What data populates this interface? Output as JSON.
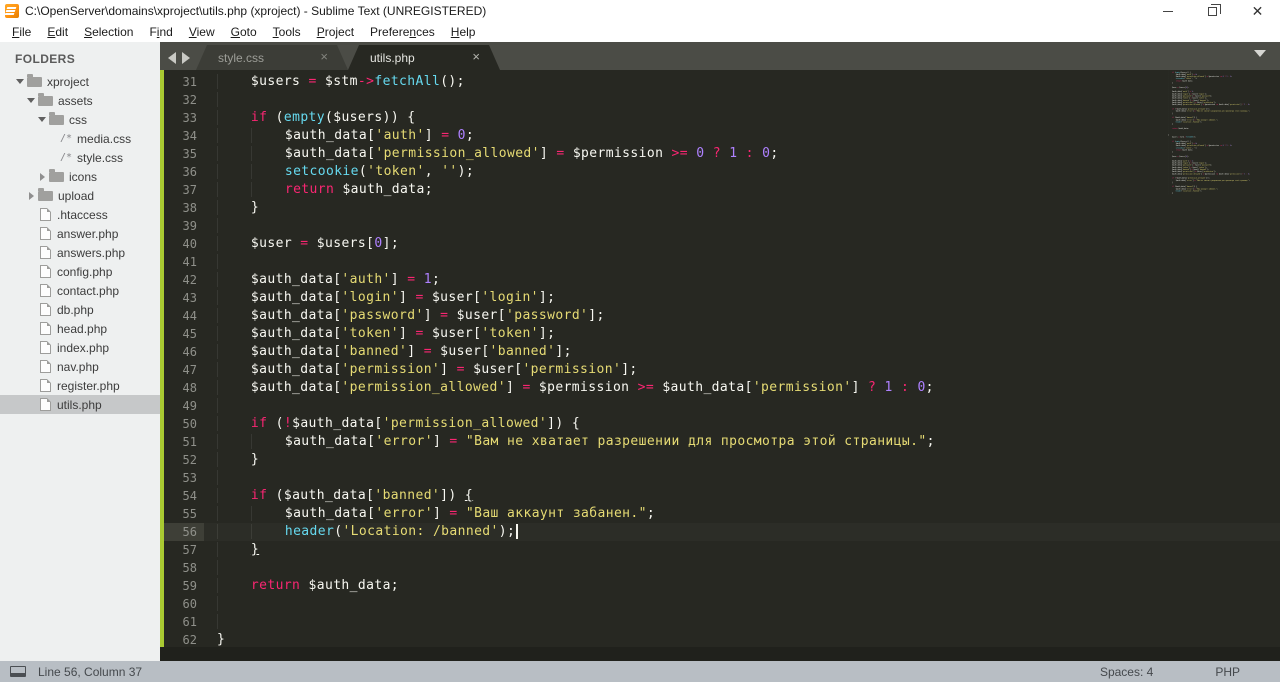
{
  "window": {
    "title": "C:\\OpenServer\\domains\\xproject\\utils.php (xproject) - Sublime Text (UNREGISTERED)",
    "controls": [
      "minimize",
      "restore",
      "close"
    ]
  },
  "menu": {
    "items": [
      {
        "label": "File",
        "accel": 0
      },
      {
        "label": "Edit",
        "accel": 0
      },
      {
        "label": "Selection",
        "accel": 0
      },
      {
        "label": "Find",
        "accel": 1
      },
      {
        "label": "View",
        "accel": 0
      },
      {
        "label": "Goto",
        "accel": 0
      },
      {
        "label": "Tools",
        "accel": 0
      },
      {
        "label": "Project",
        "accel": 0
      },
      {
        "label": "Preferences",
        "accel": 7
      },
      {
        "label": "Help",
        "accel": 0
      }
    ]
  },
  "sidebar": {
    "header": "FOLDERS",
    "items": [
      {
        "label": "xproject",
        "type": "folder",
        "depth": 0,
        "expanded": true
      },
      {
        "label": "assets",
        "type": "folder",
        "depth": 1,
        "expanded": true
      },
      {
        "label": "css",
        "type": "folder",
        "depth": 2,
        "expanded": true
      },
      {
        "label": "media.css",
        "type": "css",
        "depth": 3
      },
      {
        "label": "style.css",
        "type": "css",
        "depth": 3
      },
      {
        "label": "icons",
        "type": "folder",
        "depth": 2,
        "expanded": false
      },
      {
        "label": "upload",
        "type": "folder",
        "depth": 1,
        "expanded": false
      },
      {
        "label": ".htaccess",
        "type": "file",
        "depth": 1
      },
      {
        "label": "answer.php",
        "type": "file",
        "depth": 1
      },
      {
        "label": "answers.php",
        "type": "file",
        "depth": 1
      },
      {
        "label": "config.php",
        "type": "file",
        "depth": 1
      },
      {
        "label": "contact.php",
        "type": "file",
        "depth": 1
      },
      {
        "label": "db.php",
        "type": "file",
        "depth": 1
      },
      {
        "label": "head.php",
        "type": "file",
        "depth": 1
      },
      {
        "label": "index.php",
        "type": "file",
        "depth": 1
      },
      {
        "label": "nav.php",
        "type": "file",
        "depth": 1
      },
      {
        "label": "register.php",
        "type": "file",
        "depth": 1
      },
      {
        "label": "utils.php",
        "type": "file",
        "depth": 1,
        "selected": true
      }
    ]
  },
  "tabs": [
    {
      "label": "style.css",
      "active": false
    },
    {
      "label": "utils.php",
      "active": true
    }
  ],
  "editor": {
    "caret_line": 56,
    "lines": [
      {
        "n": 31,
        "i": 4,
        "t": [
          [
            "$users ",
            "v"
          ],
          [
            "=",
            "k"
          ],
          [
            " $stm",
            "v"
          ],
          [
            "->",
            "k"
          ],
          [
            "fetchAll",
            "f"
          ],
          [
            "();",
            "v"
          ]
        ]
      },
      {
        "n": 32,
        "i": 4,
        "t": []
      },
      {
        "n": 33,
        "i": 4,
        "t": [
          [
            "if",
            "k"
          ],
          [
            " (",
            "v"
          ],
          [
            "empty",
            "f"
          ],
          [
            "($users)) {",
            "v"
          ]
        ]
      },
      {
        "n": 34,
        "i": 8,
        "t": [
          [
            "$auth_data[",
            "v"
          ],
          [
            "'auth'",
            "s"
          ],
          [
            "] ",
            "v"
          ],
          [
            "=",
            "k"
          ],
          [
            " ",
            "v"
          ],
          [
            "0",
            "n"
          ],
          [
            ";",
            "v"
          ]
        ]
      },
      {
        "n": 35,
        "i": 8,
        "t": [
          [
            "$auth_data[",
            "v"
          ],
          [
            "'permission_allowed'",
            "s"
          ],
          [
            "] ",
            "v"
          ],
          [
            "=",
            "k"
          ],
          [
            " $permission ",
            "v"
          ],
          [
            ">=",
            "k"
          ],
          [
            " ",
            "v"
          ],
          [
            "0",
            "n"
          ],
          [
            " ",
            "v"
          ],
          [
            "?",
            "k"
          ],
          [
            " ",
            "v"
          ],
          [
            "1",
            "n"
          ],
          [
            " ",
            "v"
          ],
          [
            ":",
            "k"
          ],
          [
            " ",
            "v"
          ],
          [
            "0",
            "n"
          ],
          [
            ";",
            "v"
          ]
        ]
      },
      {
        "n": 36,
        "i": 8,
        "t": [
          [
            "setcookie",
            "f"
          ],
          [
            "(",
            "v"
          ],
          [
            "'token'",
            "s"
          ],
          [
            ", ",
            "v"
          ],
          [
            "''",
            "s"
          ],
          [
            ");",
            "v"
          ]
        ]
      },
      {
        "n": 37,
        "i": 8,
        "t": [
          [
            "return",
            "k"
          ],
          [
            " $auth_data;",
            "v"
          ]
        ]
      },
      {
        "n": 38,
        "i": 4,
        "t": [
          [
            "}",
            "v"
          ]
        ]
      },
      {
        "n": 39,
        "i": 4,
        "t": []
      },
      {
        "n": 40,
        "i": 4,
        "t": [
          [
            "$user ",
            "v"
          ],
          [
            "=",
            "k"
          ],
          [
            " $users[",
            "v"
          ],
          [
            "0",
            "n"
          ],
          [
            "];",
            "v"
          ]
        ]
      },
      {
        "n": 41,
        "i": 4,
        "t": []
      },
      {
        "n": 42,
        "i": 4,
        "t": [
          [
            "$auth_data[",
            "v"
          ],
          [
            "'auth'",
            "s"
          ],
          [
            "] ",
            "v"
          ],
          [
            "=",
            "k"
          ],
          [
            " ",
            "v"
          ],
          [
            "1",
            "n"
          ],
          [
            ";",
            "v"
          ]
        ]
      },
      {
        "n": 43,
        "i": 4,
        "t": [
          [
            "$auth_data[",
            "v"
          ],
          [
            "'login'",
            "s"
          ],
          [
            "] ",
            "v"
          ],
          [
            "=",
            "k"
          ],
          [
            " $user[",
            "v"
          ],
          [
            "'login'",
            "s"
          ],
          [
            "];",
            "v"
          ]
        ]
      },
      {
        "n": 44,
        "i": 4,
        "t": [
          [
            "$auth_data[",
            "v"
          ],
          [
            "'password'",
            "s"
          ],
          [
            "] ",
            "v"
          ],
          [
            "=",
            "k"
          ],
          [
            " $user[",
            "v"
          ],
          [
            "'password'",
            "s"
          ],
          [
            "];",
            "v"
          ]
        ]
      },
      {
        "n": 45,
        "i": 4,
        "t": [
          [
            "$auth_data[",
            "v"
          ],
          [
            "'token'",
            "s"
          ],
          [
            "] ",
            "v"
          ],
          [
            "=",
            "k"
          ],
          [
            " $user[",
            "v"
          ],
          [
            "'token'",
            "s"
          ],
          [
            "];",
            "v"
          ]
        ]
      },
      {
        "n": 46,
        "i": 4,
        "t": [
          [
            "$auth_data[",
            "v"
          ],
          [
            "'banned'",
            "s"
          ],
          [
            "] ",
            "v"
          ],
          [
            "=",
            "k"
          ],
          [
            " $user[",
            "v"
          ],
          [
            "'banned'",
            "s"
          ],
          [
            "];",
            "v"
          ]
        ]
      },
      {
        "n": 47,
        "i": 4,
        "t": [
          [
            "$auth_data[",
            "v"
          ],
          [
            "'permission'",
            "s"
          ],
          [
            "] ",
            "v"
          ],
          [
            "=",
            "k"
          ],
          [
            " $user[",
            "v"
          ],
          [
            "'permission'",
            "s"
          ],
          [
            "];",
            "v"
          ]
        ]
      },
      {
        "n": 48,
        "i": 4,
        "t": [
          [
            "$auth_data[",
            "v"
          ],
          [
            "'permission_allowed'",
            "s"
          ],
          [
            "] ",
            "v"
          ],
          [
            "=",
            "k"
          ],
          [
            " $permission ",
            "v"
          ],
          [
            ">=",
            "k"
          ],
          [
            " $auth_data[",
            "v"
          ],
          [
            "'permission'",
            "s"
          ],
          [
            "] ",
            "v"
          ],
          [
            "?",
            "k"
          ],
          [
            " ",
            "v"
          ],
          [
            "1",
            "n"
          ],
          [
            " ",
            "v"
          ],
          [
            ":",
            "k"
          ],
          [
            " ",
            "v"
          ],
          [
            "0",
            "n"
          ],
          [
            ";",
            "v"
          ]
        ]
      },
      {
        "n": 49,
        "i": 4,
        "t": []
      },
      {
        "n": 50,
        "i": 4,
        "t": [
          [
            "if",
            "k"
          ],
          [
            " (",
            "v"
          ],
          [
            "!",
            "k"
          ],
          [
            "$auth_data[",
            "v"
          ],
          [
            "'permission_allowed'",
            "s"
          ],
          [
            "]) {",
            "v"
          ]
        ]
      },
      {
        "n": 51,
        "i": 8,
        "t": [
          [
            "$auth_data[",
            "v"
          ],
          [
            "'error'",
            "s"
          ],
          [
            "] ",
            "v"
          ],
          [
            "=",
            "k"
          ],
          [
            " ",
            "v"
          ],
          [
            "\"Вам не хватает разрешении для просмотра этой страницы.\"",
            "s"
          ],
          [
            ";",
            "v"
          ]
        ]
      },
      {
        "n": 52,
        "i": 4,
        "t": [
          [
            "}",
            "v"
          ]
        ]
      },
      {
        "n": 53,
        "i": 4,
        "t": []
      },
      {
        "n": 54,
        "i": 4,
        "t": [
          [
            "if",
            "k"
          ],
          [
            " ($auth_data[",
            "v"
          ],
          [
            "'banned'",
            "s"
          ],
          [
            "]) ",
            "v"
          ],
          [
            "{",
            "v u"
          ]
        ]
      },
      {
        "n": 55,
        "i": 8,
        "t": [
          [
            "$auth_data[",
            "v"
          ],
          [
            "'error'",
            "s"
          ],
          [
            "] ",
            "v"
          ],
          [
            "=",
            "k"
          ],
          [
            " ",
            "v"
          ],
          [
            "\"Ваш аккаунт забанен.\"",
            "s"
          ],
          [
            ";",
            "v"
          ]
        ]
      },
      {
        "n": 56,
        "i": 8,
        "t": [
          [
            "header",
            "f"
          ],
          [
            "(",
            "v"
          ],
          [
            "'Location: /banned'",
            "s"
          ],
          [
            ");",
            "v"
          ]
        ]
      },
      {
        "n": 57,
        "i": 4,
        "t": [
          [
            "}",
            "v u"
          ]
        ]
      },
      {
        "n": 58,
        "i": 4,
        "t": []
      },
      {
        "n": 59,
        "i": 4,
        "t": [
          [
            "return",
            "k"
          ],
          [
            " $auth_data;",
            "v"
          ]
        ]
      },
      {
        "n": 60,
        "i": 4,
        "t": []
      },
      {
        "n": 61,
        "i": 4,
        "t": []
      },
      {
        "n": 62,
        "i": 0,
        "t": [
          [
            "}",
            "v"
          ]
        ]
      }
    ]
  },
  "statusbar": {
    "line_col": "Line 56, Column 37",
    "spaces": "Spaces: 4",
    "syntax": "PHP"
  },
  "theme": {
    "bg-editor": "#272822",
    "fg-code": "#f8f8f2",
    "kw": "#f92672",
    "str": "#e6db74",
    "num": "#ae81ff",
    "fn": "#66d9ef",
    "gutter": "#8f908a",
    "strip": "#a9c932",
    "tabbar": "#4b4c46",
    "tab-inactive": "#3c3d37",
    "sidebar-bg": "#eef0f0",
    "sidebar-sel": "#c6c8c9",
    "statusbar": "#b8bec4",
    "titlebar": "#ffffff"
  }
}
